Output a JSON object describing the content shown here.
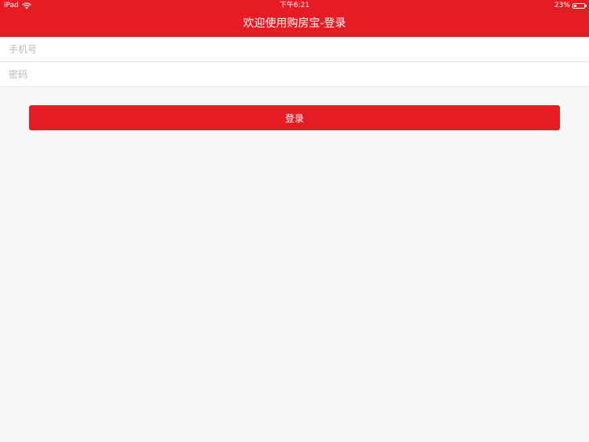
{
  "status_bar": {
    "device": "iPad",
    "time": "下午6:21",
    "battery_text": "23%",
    "battery_level": 0.23
  },
  "header": {
    "title": "欢迎使用购房宝-登录"
  },
  "form": {
    "phone_placeholder": "手机号",
    "password_placeholder": "密码"
  },
  "login": {
    "label": "登录"
  },
  "colors": {
    "brand": "#e61c24",
    "background": "#f7f7f7"
  }
}
